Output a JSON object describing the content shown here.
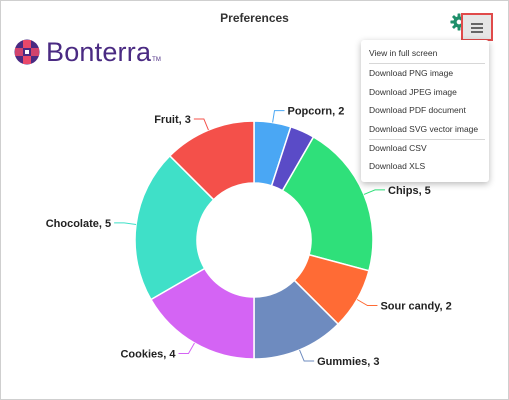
{
  "header": {
    "brand_name": "Bonterra",
    "brand_tm": "TM"
  },
  "toolbar": {
    "settings_icon": "gear-icon",
    "menu_icon": "hamburger-icon"
  },
  "export_menu": {
    "items": [
      "View in full screen",
      "Download PNG image",
      "Download JPEG image",
      "Download PDF document",
      "Download SVG vector image",
      "Download CSV",
      "Download XLS"
    ]
  },
  "chart_data": {
    "type": "pie",
    "title": "Preferences",
    "donut": true,
    "categories": [
      "Popcorn",
      "Chips",
      "Sour candy",
      "Gummies",
      "Cookies",
      "Chocolate",
      "Fruit"
    ],
    "values": [
      2,
      5,
      2,
      3,
      4,
      5,
      3
    ],
    "data_labels": [
      "Popcorn, 2",
      "Chips, 5",
      "Sour candy, 2",
      "Gummies, 3",
      "Cookies, 4",
      "Chocolate, 5",
      "Fruit, 3"
    ],
    "colors": [
      "#4aa7f4",
      "#5a4bc7",
      "#2fe07a",
      "#ff6b35",
      "#6e8bbf",
      "#d464f4",
      "#3fe0c8",
      "#f4504a"
    ]
  }
}
